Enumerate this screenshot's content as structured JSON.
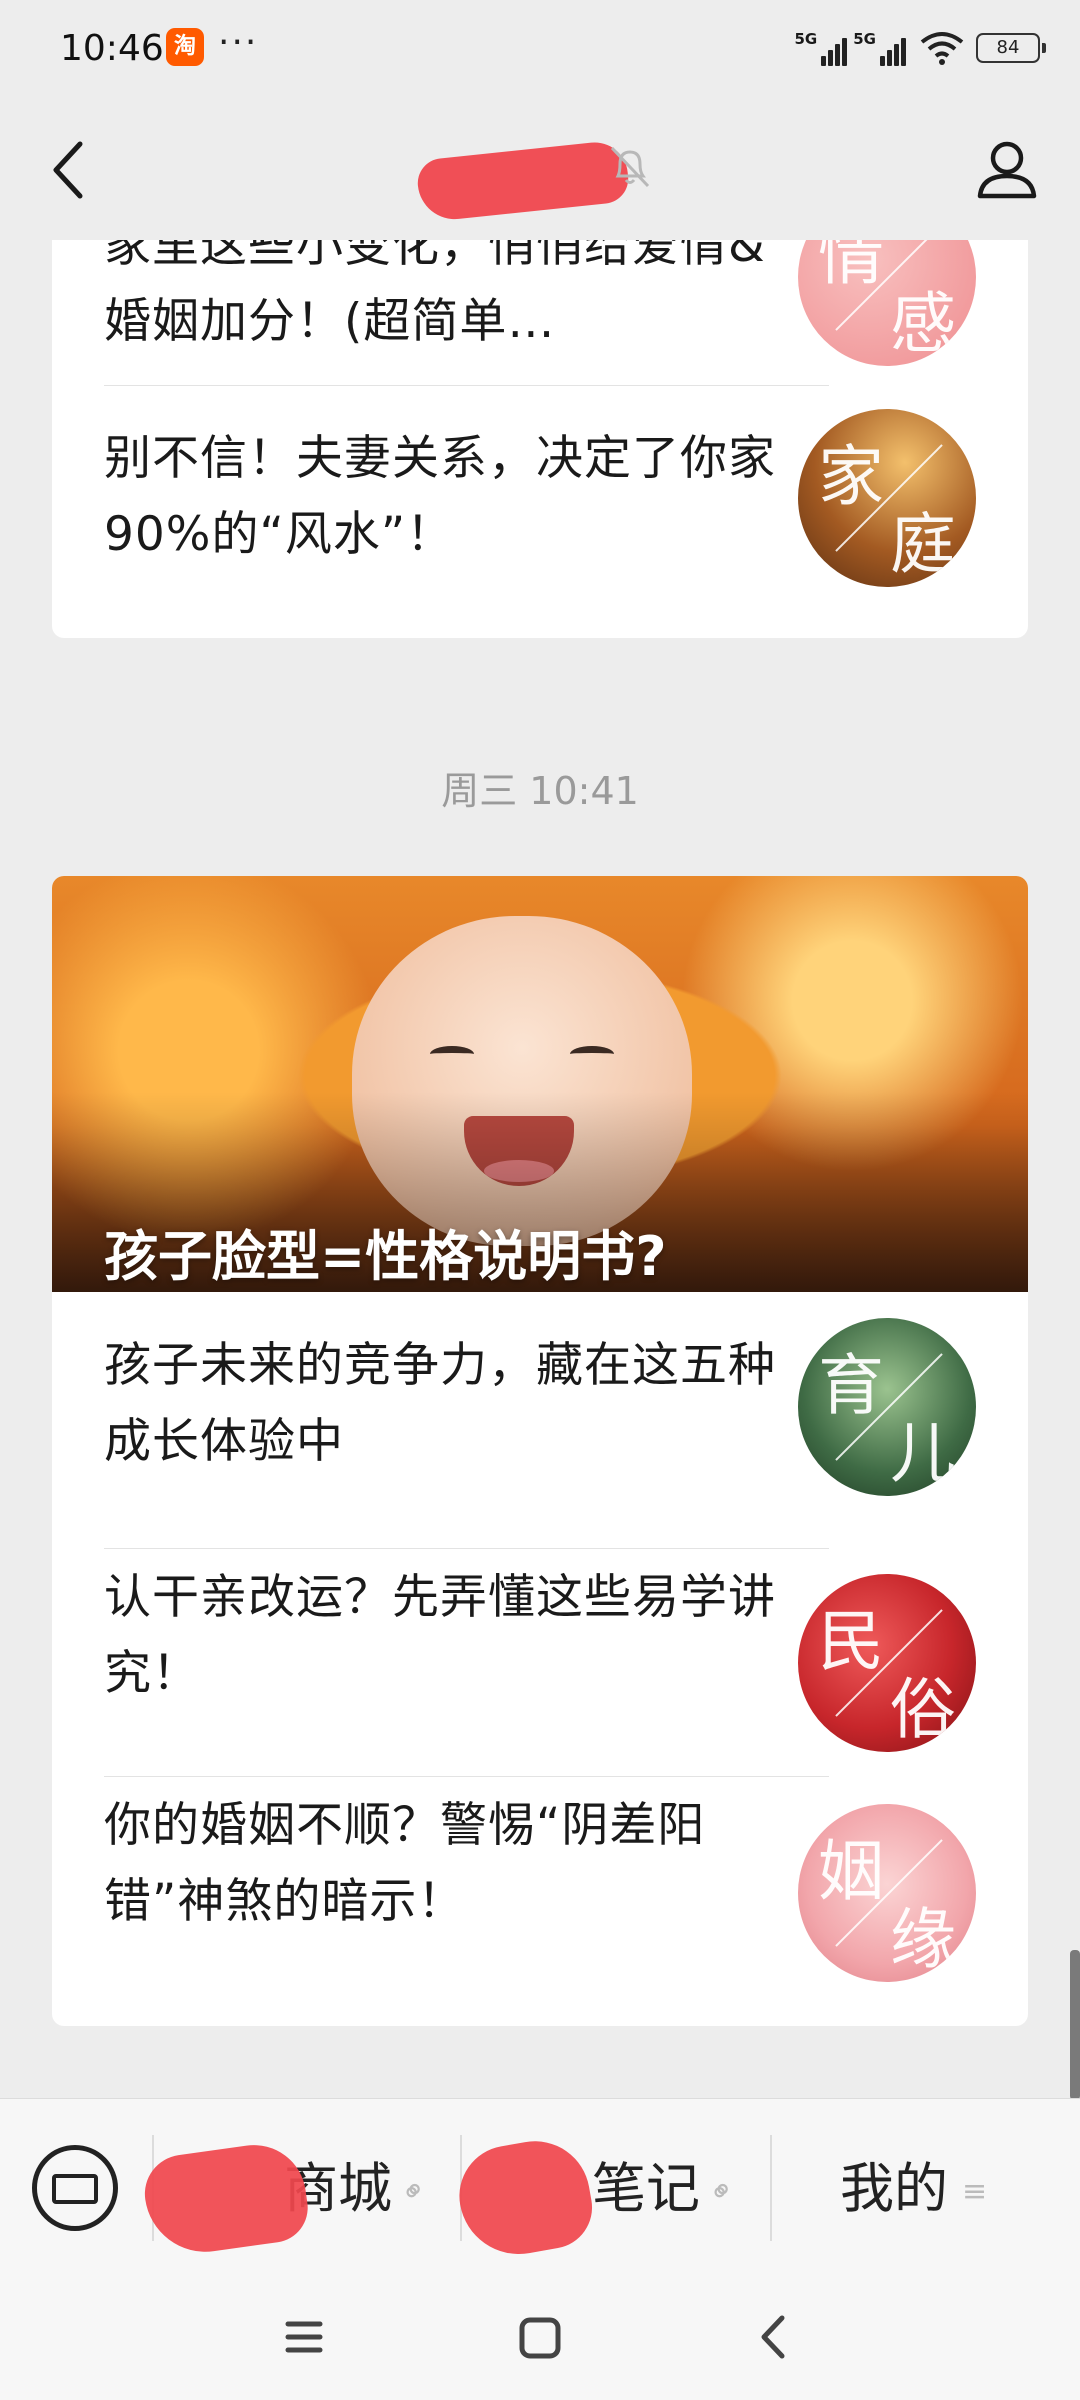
{
  "status_bar": {
    "time": "10:46",
    "notification_app_icon": "taobao-icon",
    "notification_app_glyph": "淘",
    "more_indicator": "···",
    "network_1": "5G",
    "network_2": "5G",
    "battery": "84"
  },
  "nav": {
    "back_icon": "chevron-left-icon",
    "title": "",
    "mute_icon": "bell-off-icon",
    "profile_icon": "person-icon"
  },
  "articles_top": [
    {
      "title": "家里这些小变化，悄悄给爱情&婚姻加分！(超简单…",
      "thumb_chars": [
        "情",
        "感"
      ],
      "thumb_color": "#f4a7a8"
    },
    {
      "title": "别不信！夫妻关系，决定了你家90%的“风水”！",
      "thumb_chars": [
        "家",
        "庭"
      ],
      "thumb_color": "#b06a2b"
    }
  ],
  "timestamp": "周三 10:41",
  "hero": {
    "title": "孩子脸型=性格说明书?"
  },
  "articles_bottom": [
    {
      "title": "孩子未来的竞争力，藏在这五种成长体验中",
      "thumb_chars": [
        "育",
        "儿"
      ],
      "thumb_color": "#3f6b45"
    },
    {
      "title": "认干亲改运？先弄懂这些易学讲究！",
      "thumb_chars": [
        "民",
        "俗"
      ],
      "thumb_color": "#c7262b"
    },
    {
      "title": "你的婚姻不顺？警惕“阴差阳错”神煞的暗示！",
      "thumb_chars": [
        "姻",
        "缘"
      ],
      "thumb_color": "#f2a6ab"
    }
  ],
  "menu": {
    "keyboard_icon": "keyboard-icon",
    "item_1": "商城",
    "item_2": "笔记",
    "item_3": "我的",
    "link_icon": "link-icon",
    "list_icon": "list-icon"
  },
  "system_nav": {
    "menu_icon": "menu-icon",
    "home_icon": "home-icon",
    "back_icon": "back-icon"
  }
}
